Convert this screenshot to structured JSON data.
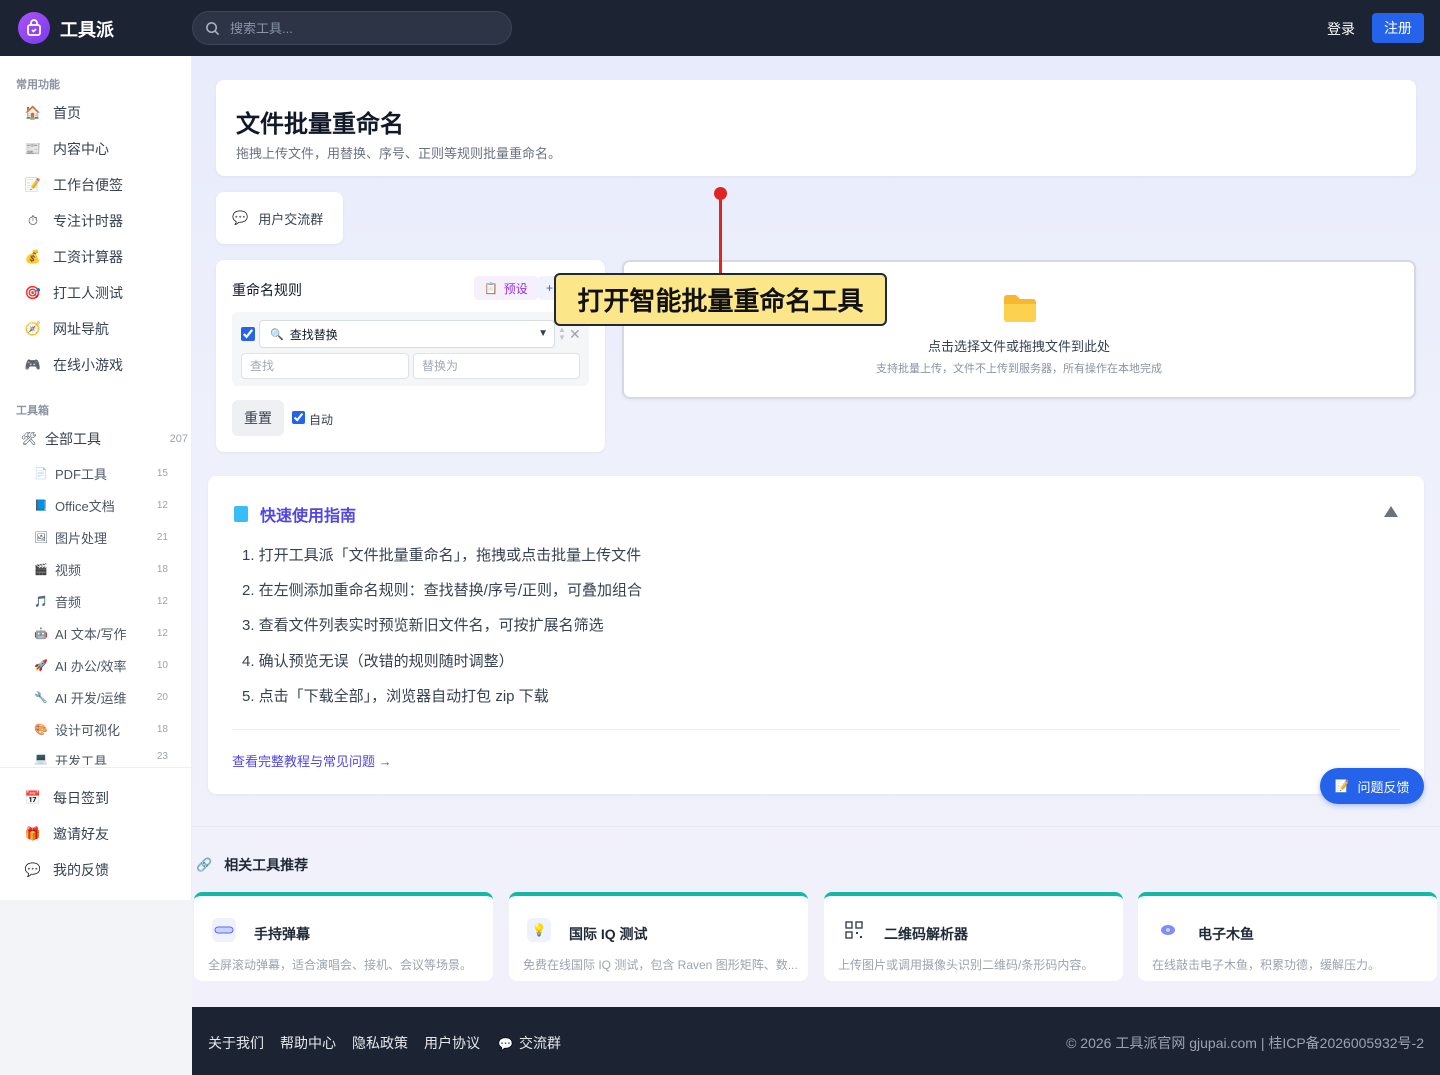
{
  "header": {
    "brand": "工具派",
    "search_placeholder": "搜索工具...",
    "login": "登录",
    "signup": "注册"
  },
  "sidebar": {
    "common_label": "常用功能",
    "common_items": [
      {
        "label": "首页",
        "icon": "house-icon"
      },
      {
        "label": "内容中心",
        "icon": "newspaper-icon"
      },
      {
        "label": "工作台便签",
        "icon": "memo-icon"
      },
      {
        "label": "专注计时器",
        "icon": "stopwatch-icon"
      },
      {
        "label": "工资计算器",
        "icon": "money-bag-icon"
      },
      {
        "label": "打工人测试",
        "icon": "target-icon"
      },
      {
        "label": "网址导航",
        "icon": "compass-icon"
      },
      {
        "label": "在线小游戏",
        "icon": "gamepad-icon"
      }
    ],
    "toolbox_label": "工具箱",
    "all_tools": {
      "label": "全部工具",
      "count": "207"
    },
    "tools": [
      {
        "label": "PDF工具",
        "count": "15",
        "icon": "pdf-icon"
      },
      {
        "label": "Office文档",
        "count": "12",
        "icon": "book-icon"
      },
      {
        "label": "图片处理",
        "count": "21",
        "icon": "picture-icon"
      },
      {
        "label": "视频",
        "count": "18",
        "icon": "clapper-icon"
      },
      {
        "label": "音频",
        "count": "12",
        "icon": "music-note-icon"
      },
      {
        "label": "AI 文本/写作",
        "count": "12",
        "icon": "robot-icon"
      },
      {
        "label": "AI 办公/效率",
        "count": "10",
        "icon": "rocket-icon"
      },
      {
        "label": "AI 开发/运维",
        "count": "20",
        "icon": "wrench-icon"
      },
      {
        "label": "设计可视化",
        "count": "18",
        "icon": "palette-icon"
      },
      {
        "label": "开发工具",
        "count": "23",
        "icon": "computer-icon"
      }
    ],
    "bottom_items": [
      {
        "label": "每日签到",
        "icon": "calendar-icon"
      },
      {
        "label": "邀请好友",
        "icon": "gift-icon"
      },
      {
        "label": "我的反馈",
        "icon": "speech-bubble-icon"
      }
    ]
  },
  "page": {
    "title": "文件批量重命名",
    "subtitle": "拖拽上传文件，用替换、序号、正则等规则批量重命名。",
    "group_button": "用户交流群"
  },
  "rules": {
    "title": "重命名规则",
    "preset": "预设",
    "add": "+",
    "rule_type": "查找替换",
    "find_placeholder": "查找",
    "replace_placeholder": "替换为",
    "reset": "重置",
    "auto": "自动",
    "enabled": true,
    "auto_checked": true
  },
  "dropzone": {
    "main": "点击选择文件或拖拽文件到此处",
    "sub": "支持批量上传，文件不上传到服务器，所有操作在本地完成"
  },
  "callout": "打开智能批量重命名工具",
  "guide": {
    "title": "快速使用指南",
    "steps": [
      "1. 打开工具派「文件批量重命名」，拖拽或点击批量上传文件",
      "2. 在左侧添加重命名规则：查找替换/序号/正则，可叠加组合",
      "3. 查看文件列表实时预览新旧文件名，可按扩展名筛选",
      "4. 确认预览无误（改错的规则随时调整）",
      "5. 点击「下载全部」，浏览器自动打包 zip 下载"
    ],
    "link": "查看完整教程与常见问题 →"
  },
  "feedback": "问题反馈",
  "related": {
    "title": "相关工具推荐",
    "cards": [
      {
        "name": "手持弹幕",
        "desc": "全屏滚动弹幕，适合演唱会、接机、会议等场景。",
        "icon": "barrage-icon"
      },
      {
        "name": "国际 IQ 测试",
        "desc": "免费在线国际 IQ 测试，包含 Raven 图形矩阵、数...",
        "icon": "lightbulb-icon"
      },
      {
        "name": "二维码解析器",
        "desc": "上传图片或调用摄像头识别二维码/条形码内容。",
        "icon": "qr-code-icon"
      },
      {
        "name": "电子木鱼",
        "desc": "在线敲击电子木鱼，积累功德，缓解压力。",
        "icon": "wooden-fish-icon"
      }
    ]
  },
  "footer": {
    "links": [
      "关于我们",
      "帮助中心",
      "隐私政策",
      "用户协议"
    ],
    "group": "交流群",
    "copyright": "© 2026 工具派官网 gjupai.com | 桂ICP备2026005932号-2"
  },
  "colors": {
    "accent": "#2563eb",
    "header_bg": "#1c2333",
    "callout_bg": "#fbe78a",
    "callout_line": "#e02424",
    "guide_title": "#4f46e5",
    "card_top": "#14b8a6"
  }
}
